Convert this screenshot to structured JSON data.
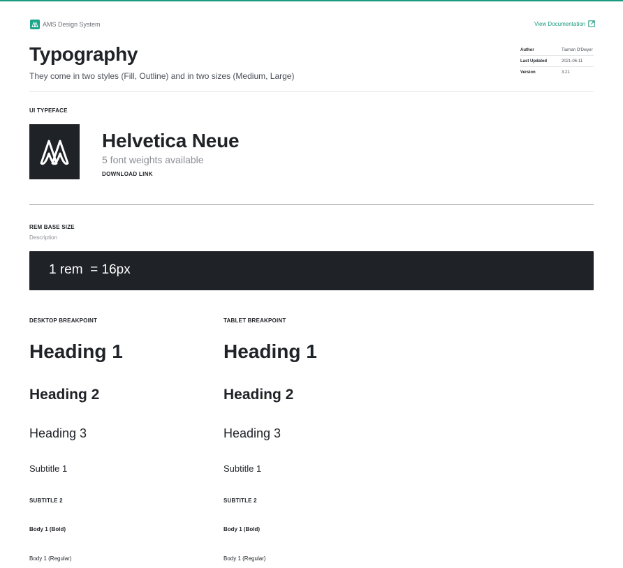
{
  "header": {
    "brand_name": "AMS Design System",
    "doc_link_label": "View Documentation",
    "title": "Typography",
    "description": "They come in two styles (Fill, Outline) and in two sizes (Medium, Large)"
  },
  "meta": [
    {
      "key": "Author",
      "value": "Tiarnan O'Dwyer"
    },
    {
      "key": "Last Updated",
      "value": "2021-06-11"
    },
    {
      "key": "Version",
      "value": "3.21"
    }
  ],
  "ui_typeface": {
    "label": "UI TYPEFACE",
    "name": "Helvetica Neue",
    "weights": "5 font weights available",
    "download_label": "DOWNLOAD LINK"
  },
  "rem": {
    "label": "REM BASE SIZE",
    "description": "Description",
    "value": "1 rem  = 16px"
  },
  "breakpoints": [
    {
      "label": "DESKTOP BREAKPOINT",
      "samples": {
        "h1": "Heading 1",
        "h2": "Heading 2",
        "h3": "Heading 3",
        "subtitle1": "Subtitle 1",
        "subtitle2": "SUBTITLE 2",
        "body_bold": "Body 1 (Bold)",
        "body_regular": "Body 1 (Regular)"
      }
    },
    {
      "label": "TABLET BREAKPOINT",
      "samples": {
        "h1": "Heading 1",
        "h2": "Heading 2",
        "h3": "Heading 3",
        "subtitle1": "Subtitle 1",
        "subtitle2": "SUBTITLE 2",
        "body_bold": "Body 1 (Bold)",
        "body_regular": "Body 1 (Regular)"
      }
    }
  ],
  "colors": {
    "accent": "#1a9a7f",
    "dark": "#1f2227",
    "muted": "#8a8e95"
  },
  "icons": {
    "brand": "ams-logo-icon",
    "doc_link": "external-link-icon",
    "typeface": "ams-logo-icon"
  }
}
